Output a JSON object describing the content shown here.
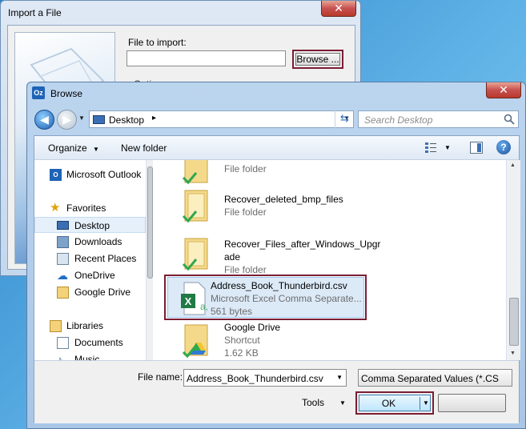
{
  "import_dialog": {
    "title": "Import a File",
    "file_label": "File to import:",
    "file_value": "",
    "browse_label": "Browse ...",
    "options_label": "Options"
  },
  "browse_dialog": {
    "title": "Browse",
    "close_label": "✕",
    "address": "Desktop",
    "search_placeholder": "Search Desktop",
    "toolbar": {
      "organize": "Organize",
      "new_folder": "New folder"
    },
    "nav_pane": {
      "items": [
        {
          "label": "Microsoft Outlook",
          "icon": "outlook-icon"
        },
        {
          "label": "Favorites",
          "icon": "star-icon"
        },
        {
          "label": "Desktop",
          "icon": "desktop-icon"
        },
        {
          "label": "Downloads",
          "icon": "downloads-icon"
        },
        {
          "label": "Recent Places",
          "icon": "recent-places-icon"
        },
        {
          "label": "OneDrive",
          "icon": "onedrive-icon"
        },
        {
          "label": "Google Drive",
          "icon": "google-drive-icon"
        },
        {
          "label": "Libraries",
          "icon": "libraries-icon"
        },
        {
          "label": "Documents",
          "icon": "documents-icon"
        },
        {
          "label": "Music",
          "icon": "music-icon"
        }
      ]
    },
    "files": [
      {
        "name": "",
        "line2": "File folder",
        "line3": ""
      },
      {
        "name": "Recover_deleted_bmp_files",
        "line2": "File folder",
        "line3": ""
      },
      {
        "name": "Recover_Files_after_Windows_Upgr",
        "name2": "ade",
        "line2": "File folder",
        "line3": ""
      },
      {
        "name": "Address_Book_Thunderbird.csv",
        "line2": "Microsoft Excel Comma Separate...",
        "line3": "561 bytes"
      },
      {
        "name": "Google Drive",
        "line2": "Shortcut",
        "line3": "1.62 KB"
      }
    ],
    "file_name_label": "File name:",
    "file_name_value": "Address_Book_Thunderbird.csv",
    "file_type_value": "Comma Separated Values (*.CS",
    "tools_label": "Tools",
    "ok_label": "OK",
    "cancel_label": "",
    "colors": {
      "highlight_outline": "#7a1d33",
      "selection": "#dceaf8"
    }
  }
}
